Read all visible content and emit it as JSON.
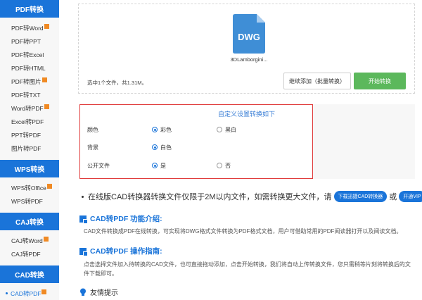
{
  "sidebar": {
    "sections": [
      {
        "title": "PDF转换",
        "items": [
          {
            "label": "PDF转Word",
            "badge": true
          },
          {
            "label": "PDF转PPT",
            "badge": false
          },
          {
            "label": "PDF转Excel",
            "badge": false
          },
          {
            "label": "PDF转HTML",
            "badge": false
          },
          {
            "label": "PDF转图片",
            "badge": true
          },
          {
            "label": "PDF转TXT",
            "badge": false
          },
          {
            "label": "Word转PDF",
            "badge": true
          },
          {
            "label": "Excel转PDF",
            "badge": false
          },
          {
            "label": "PPT转PDF",
            "badge": false
          },
          {
            "label": "图片转PDF",
            "badge": false
          }
        ]
      },
      {
        "title": "WPS转换",
        "items": [
          {
            "label": "WPS转Office",
            "badge": true
          },
          {
            "label": "WPS转PDF",
            "badge": false
          }
        ]
      },
      {
        "title": "CAJ转换",
        "items": [
          {
            "label": "CAJ转Word",
            "badge": true
          },
          {
            "label": "CAJ转PDF",
            "badge": false
          }
        ]
      },
      {
        "title": "CAD转换",
        "items": [
          {
            "label": "CAD转PDF",
            "badge": true,
            "active": true
          }
        ]
      }
    ]
  },
  "upload": {
    "file_type": "DWG",
    "file_name": "3DLamborgini...",
    "summary": "选中1个文件，共1.31M。",
    "continue_label": "继续添加（批量转换）",
    "start_label": "开始转换"
  },
  "settings": {
    "title": "自定义设置转换如下",
    "rows": [
      {
        "label": "颜色",
        "options": [
          {
            "text": "彩色",
            "checked": true
          },
          {
            "text": "黑白",
            "checked": false
          }
        ]
      },
      {
        "label": "背景",
        "options": [
          {
            "text": "白色",
            "checked": true
          }
        ]
      },
      {
        "label": "公开文件",
        "options": [
          {
            "text": "是",
            "checked": true
          },
          {
            "text": "否",
            "checked": false
          }
        ]
      }
    ]
  },
  "notice": {
    "text_before": "在线版CAD转换器转换文件仅限于2M以内文件，如需转换更大文件，请",
    "download_label": "下载迅捷CAD转换器",
    "or_text": "或",
    "vip_label": "开通VIP"
  },
  "intro": {
    "title": "CAD转PDF 功能介绍:",
    "text": "CAD文件转换成PDF在线转换，可实现将DWG格式文件转换为PDF格式文档，用户可借助常用的PDF阅读器打开以及阅读文档。"
  },
  "guide": {
    "title": "CAD转PDF 操作指南:",
    "text": "点击选择文件加入待转换的CAD文件，也可直接拖动添加，点击开始转换，我们将自动上传转换文件，您只需稍等片刻将转换后的文件下载即可。"
  },
  "tip": {
    "title": "友情提示"
  },
  "colors": {
    "brand_blue": "#1a74d9",
    "start_green": "#5cb85c",
    "settings_border": "#e03c3c",
    "badge_orange": "#f08a24"
  }
}
